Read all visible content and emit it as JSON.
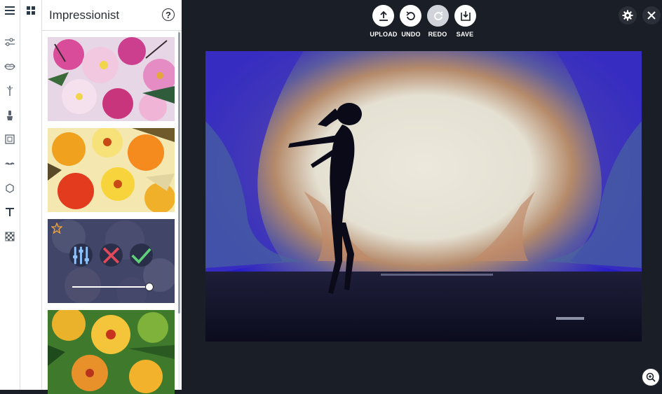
{
  "panel": {
    "title": "Impressionist",
    "help_label": "?"
  },
  "toolbar": {
    "upload_label": "UPLOAD",
    "undo_label": "UNDO",
    "redo_label": "REDO",
    "save_label": "SAVE"
  },
  "rail": {
    "icons": [
      "menu-icon",
      "adjust-sliders-icon",
      "lips-icon",
      "magic-wand-icon",
      "paint-brush-icon",
      "frame-icon",
      "mustache-icon",
      "sticker-shape-icon",
      "text-icon",
      "texture-icon"
    ]
  },
  "effect": {
    "strength": 1.0
  },
  "colors": {
    "workspace_bg": "#1a1e26",
    "panel_bg": "#ffffff",
    "confirm_green": "#5fd17a",
    "cancel_red": "#e04a5a",
    "star_orange": "#f2a43a"
  }
}
